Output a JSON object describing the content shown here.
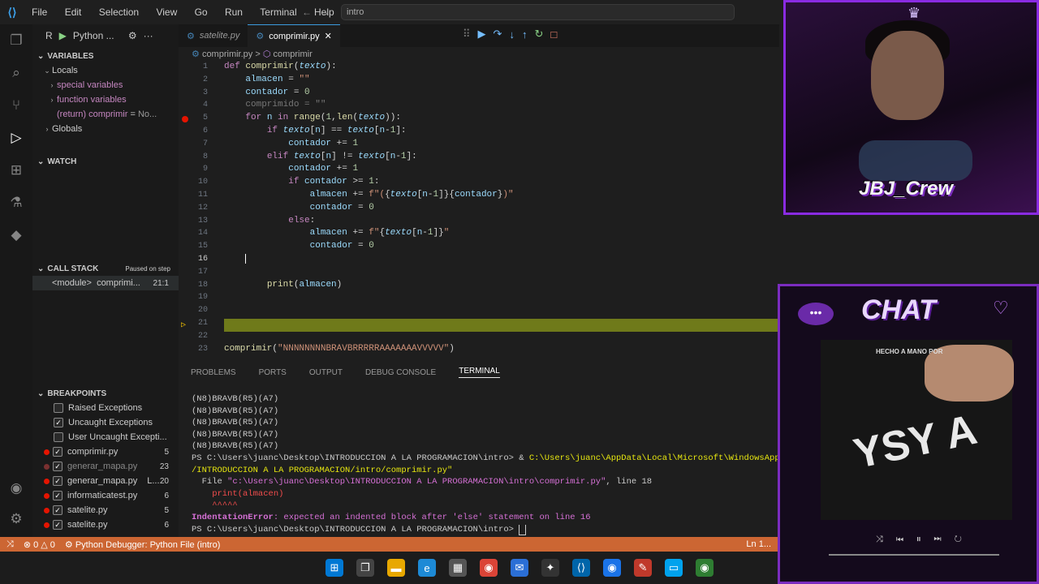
{
  "titlebar": {
    "menu": [
      "File",
      "Edit",
      "Selection",
      "View",
      "Go",
      "Run",
      "Terminal",
      "Help"
    ],
    "command_center": "intro"
  },
  "sidebar": {
    "run_prefix": "R",
    "run_config": "Python ...",
    "variables_header": "VARIABLES",
    "locals_label": "Locals",
    "vars": [
      "special variables",
      "function variables"
    ],
    "return_var": "(return) comprimir",
    "return_value": "No...",
    "globals_label": "Globals",
    "watch_header": "WATCH",
    "callstack_header": "CALL STACK",
    "callstack_status": "Paused on step",
    "frame_name": "<module>",
    "frame_file": "comprimi...",
    "frame_pos": "21:1",
    "breakpoints_header": "BREAKPOINTS",
    "bp_exceptions": [
      {
        "label": "Raised Exceptions",
        "checked": false
      },
      {
        "label": "Uncaught Exceptions",
        "checked": true
      },
      {
        "label": "User Uncaught Excepti...",
        "checked": false
      }
    ],
    "bp_files": [
      {
        "file": "comprimir.py",
        "line": "5",
        "active": true
      },
      {
        "file": "generar_mapa.py",
        "line": "23",
        "active": false
      },
      {
        "file": "generar_mapa.py",
        "extra": "L...",
        "line": "20",
        "active": true
      },
      {
        "file": "informaticatest.py",
        "line": "6",
        "active": true
      },
      {
        "file": "satelite.py",
        "line": "5",
        "active": true
      },
      {
        "file": "satelite.py",
        "line": "6",
        "active": true
      }
    ]
  },
  "tabs": [
    {
      "label": "satelite.py",
      "active": false
    },
    {
      "label": "comprimir.py",
      "active": true
    }
  ],
  "breadcrumb": {
    "file": "comprimir.py",
    "symbol": "comprimir"
  },
  "editor": {
    "line_numbers": [
      "1",
      "2",
      "3",
      "4",
      "5",
      "6",
      "7",
      "8",
      "9",
      "10",
      "11",
      "12",
      "13",
      "14",
      "15",
      "16",
      "17",
      "18",
      "19",
      "20",
      "21",
      "22",
      "23"
    ],
    "current_line": "16"
  },
  "panel_tabs": [
    "PROBLEMS",
    "PORTS",
    "OUTPUT",
    "DEBUG CONSOLE",
    "TERMINAL"
  ],
  "terminal": {
    "out_lines": [
      "(N8)BRAVB(R5)(A7)",
      "(N8)BRAVB(R5)(A7)",
      "(N8)BRAVB(R5)(A7)",
      "(N8)BRAVB(R5)(A7)",
      "(N8)BRAVB(R5)(A7)"
    ],
    "ps1": "PS C:\\Users\\juanc\\Desktop\\INTRODUCCION A LA PROGRAMACION\\intro> & ",
    "ps1_exe": "C:\\Users\\juanc\\AppData\\Local\\Microsoft\\WindowsApps\\pytho",
    "ps1_cont": "/INTRODUCCION A LA PROGRAMACION/intro/comprimir.py\"",
    "file_label": "  File ",
    "file_path": "\"c:\\Users\\juanc\\Desktop\\INTRODUCCION A LA PROGRAMACION\\intro\\comprimir.py\"",
    "file_line": ", line 18",
    "print_line": "    print(almacen)",
    "caret_line": "    ^^^^^",
    "error_name": "IndentationError",
    "error_msg": ": expected an indented block after 'else' statement on line 16",
    "ps2": "PS C:\\Users\\juanc\\Desktop\\INTRODUCCION A LA PROGRAMACION\\intro> "
  },
  "statusbar": {
    "errors": "0",
    "warnings": "0",
    "debug": "Python Debugger: Python File (intro)",
    "right": "Ln 1..."
  },
  "stream": {
    "crew": "JBJ_Crew",
    "chat_title": "CHAT",
    "merch_small": "HECHO A MANO POR",
    "merch_big": "YSY A"
  }
}
